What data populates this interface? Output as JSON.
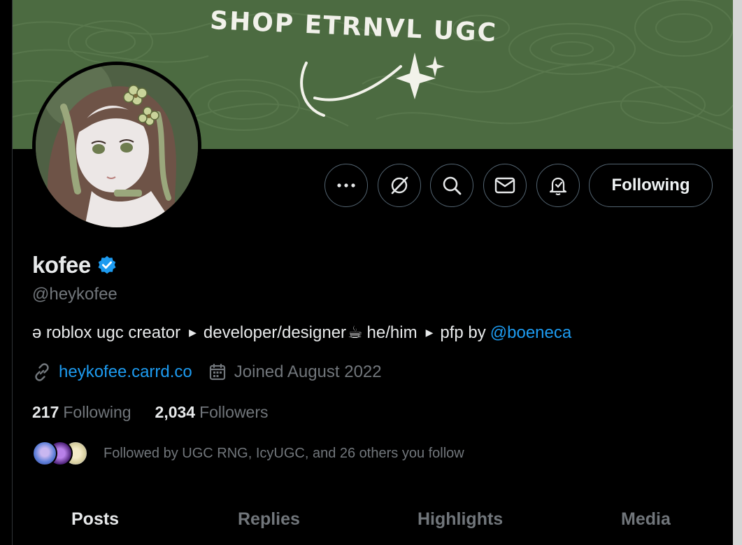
{
  "banner": {
    "title": "SHOP ETRNVL UGC",
    "background_color": "#4c6b41"
  },
  "profile": {
    "display_name": "kofee",
    "verified_icon": "verified-badge-icon",
    "handle": "@heykofee",
    "bio": {
      "part1": "ə roblox ugc creator",
      "part2": "developer/designer",
      "emoji": "☕",
      "part3": "he/him",
      "part4": "pfp by",
      "mention": "@boeneca"
    },
    "website": "heykofee.carrd.co",
    "joined": "Joined August 2022",
    "following_count": "217",
    "following_label": "Following",
    "followers_count": "2,034",
    "followers_label": "Followers",
    "followed_by": "Followed by UGC RNG, IcyUGC, and 26 others you follow"
  },
  "actions": {
    "more": "more-icon",
    "grok": "grok-icon",
    "search": "search-icon",
    "message": "mail-icon",
    "notify": "bell-icon",
    "follow_label": "Following"
  },
  "tabs": [
    {
      "label": "Posts",
      "active": true
    },
    {
      "label": "Replies",
      "active": false
    },
    {
      "label": "Highlights",
      "active": false
    },
    {
      "label": "Media",
      "active": false
    }
  ],
  "colors": {
    "accent": "#1d9bf0",
    "muted": "#71767b",
    "text": "#e7e9ea"
  }
}
